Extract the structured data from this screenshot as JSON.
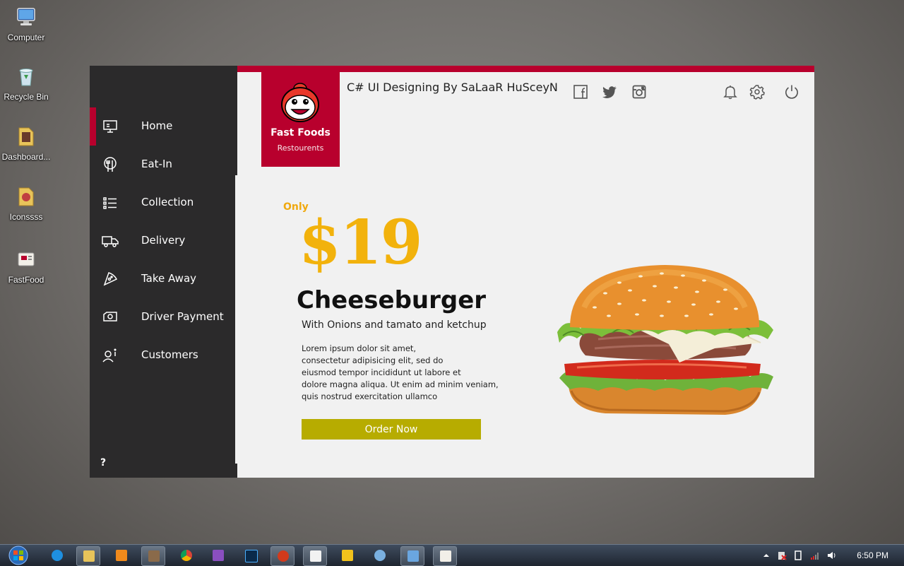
{
  "desktop": {
    "icons": [
      {
        "label": "Computer"
      },
      {
        "label": "Recycle Bin"
      },
      {
        "label": "Dashboard..."
      },
      {
        "label": "Iconssss"
      },
      {
        "label": "FastFood"
      }
    ]
  },
  "app": {
    "title": "C# UI Designing By SaLaaR HuSceyN",
    "logo": {
      "brand": "Fast Foods",
      "sub": "Restourents"
    },
    "accent": "#b8002d",
    "sidebar": {
      "items": [
        {
          "label": "Home",
          "icon": "monitor-icon",
          "active": true
        },
        {
          "label": "Eat-In",
          "icon": "dining-icon"
        },
        {
          "label": "Collection",
          "icon": "list-icon"
        },
        {
          "label": "Delivery",
          "icon": "truck-icon"
        },
        {
          "label": "Take Away",
          "icon": "pizza-slice-icon"
        },
        {
          "label": "Driver Payment",
          "icon": "cash-icon"
        },
        {
          "label": "Customers",
          "icon": "user-info-icon"
        }
      ],
      "help": "?"
    },
    "header_icons": [
      "facebook-icon",
      "twitter-icon",
      "instagram-icon",
      "bell-icon",
      "gear-icon",
      "power-icon"
    ],
    "promo": {
      "only": "Only",
      "price": "$19",
      "product": "Cheeseburger",
      "subtitle": "With Onions and tamato and ketchup",
      "description": "Lorem ipsum dolor sit amet,\n consectetur adipisicing elit, sed do\n eiusmod tempor incididunt ut labore et\ndolore magna aliqua. Ut enim ad minim veniam,\nquis nostrud exercitation ullamco",
      "button": "Order Now",
      "button_color": "#b7ac00",
      "price_color": "#f2b20c"
    }
  },
  "taskbar": {
    "clock": "6:50 PM"
  }
}
